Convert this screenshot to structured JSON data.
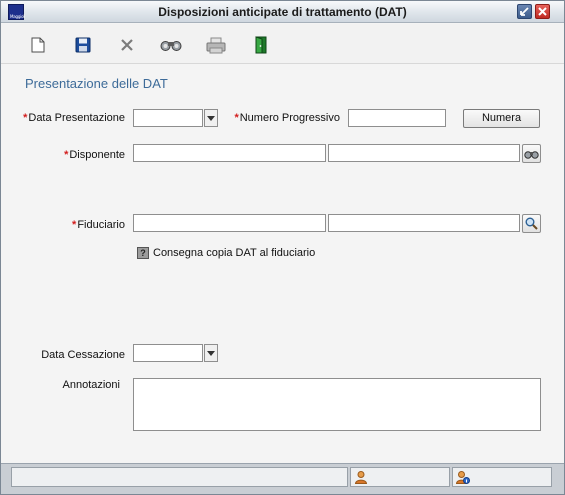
{
  "window": {
    "title": "Disposizioni anticipate di trattamento (DAT)",
    "logo_text": "Maggioli"
  },
  "toolbar": {
    "items": [
      {
        "icon": "new-document-icon"
      },
      {
        "icon": "save-icon"
      },
      {
        "icon": "delete-icon"
      },
      {
        "icon": "search-binoculars-icon"
      },
      {
        "icon": "print-icon"
      },
      {
        "icon": "exit-door-icon"
      }
    ]
  },
  "form": {
    "section_title": "Presentazione delle DAT",
    "required_marker": "*",
    "data_presentazione": {
      "label": "Data Presentazione",
      "value": ""
    },
    "numero_progressivo": {
      "label": "Numero Progressivo",
      "value": ""
    },
    "numera_button": "Numera",
    "disponente": {
      "label": "Disponente",
      "value_1": "",
      "value_2": ""
    },
    "fiduciario": {
      "label": "Fiduciario",
      "value_1": "",
      "value_2": ""
    },
    "consegna_checkbox": {
      "label": "Consegna copia DAT al fiduciario",
      "mark": "?"
    },
    "data_cessazione": {
      "label": "Data Cessazione",
      "value": ""
    },
    "annotazioni": {
      "label": "Annotazioni",
      "value": ""
    }
  },
  "statusbar": {
    "message": "",
    "user_text": "",
    "info_text": ""
  },
  "colors": {
    "section_title": "#3d6b99",
    "required": "#d21c1c"
  }
}
